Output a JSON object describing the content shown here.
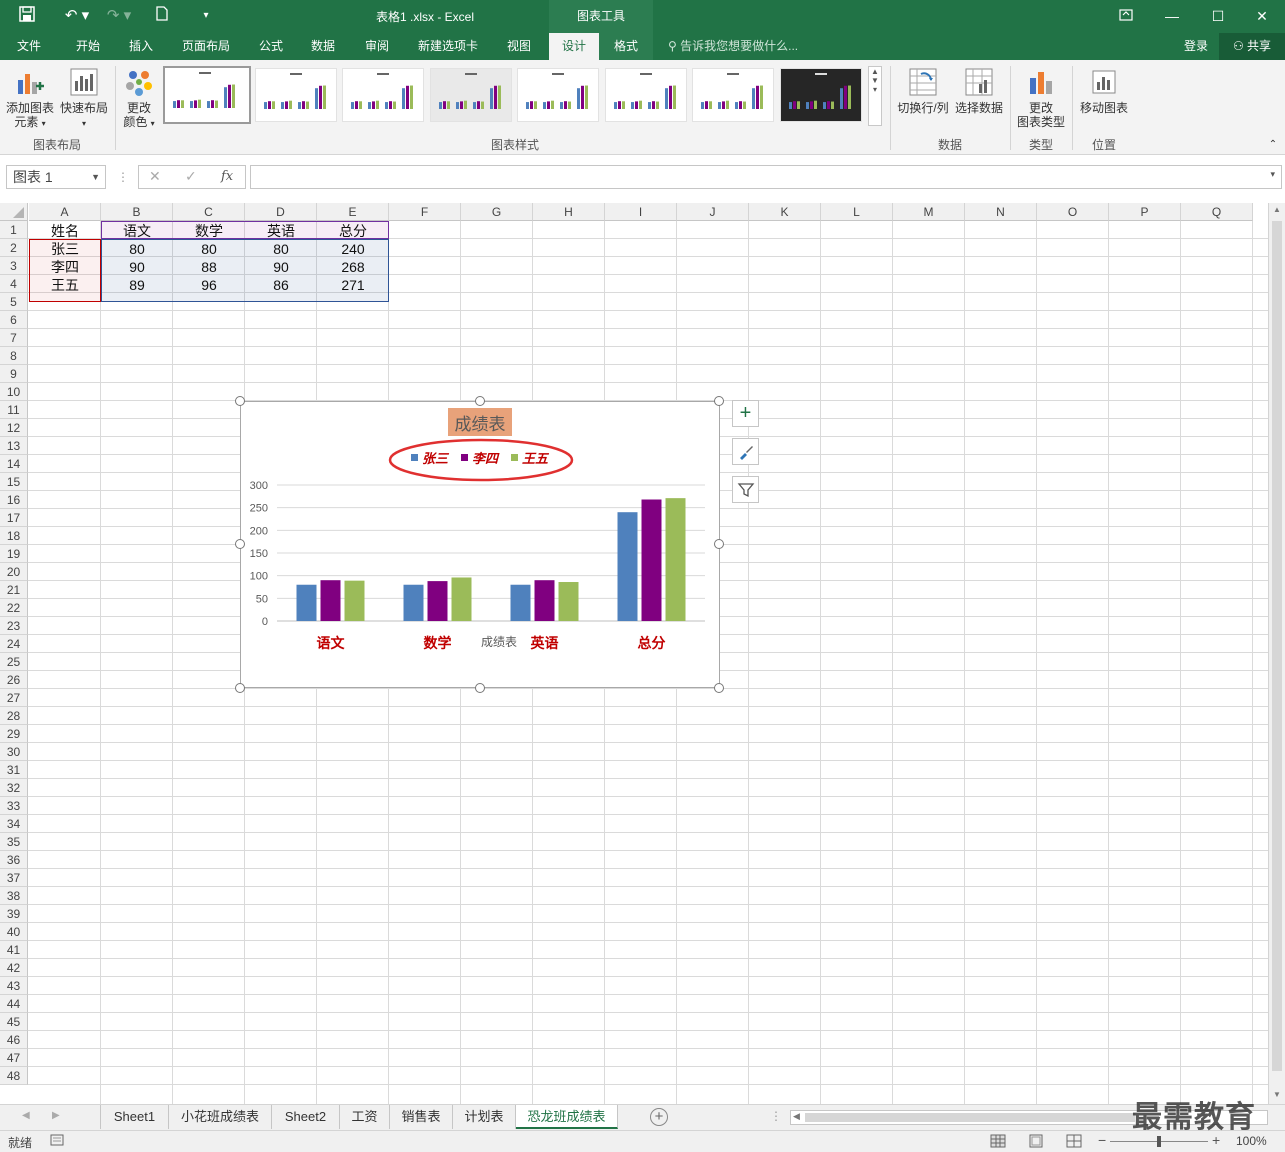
{
  "window": {
    "doc_title": "表格1 .xlsx - Excel",
    "context_tools": "图表工具"
  },
  "tabs": [
    "文件",
    "开始",
    "插入",
    "页面布局",
    "公式",
    "数据",
    "审阅",
    "新建选项卡",
    "视图",
    "设计",
    "格式"
  ],
  "active_tab": "设计",
  "tell_me": "告诉我您想要做什么...",
  "login": "登录",
  "share": "共享",
  "ribbon": {
    "add_element": [
      "添加图表",
      "元素"
    ],
    "quick_layout": "快速布局",
    "change_colors": [
      "更改",
      "颜色"
    ],
    "group_layout": "图表布局",
    "group_styles": "图表样式",
    "switch_row_col": "切换行/列",
    "select_data": "选择数据",
    "group_data": "数据",
    "change_type": [
      "更改",
      "图表类型"
    ],
    "group_type": "类型",
    "move_chart": "移动图表",
    "group_location": "位置"
  },
  "namebox": "图表 1",
  "columns": [
    "A",
    "B",
    "C",
    "D",
    "E",
    "F",
    "G",
    "H",
    "I",
    "J",
    "K",
    "L",
    "M",
    "N",
    "O",
    "P",
    "Q"
  ],
  "rows_count": 48,
  "table": {
    "header": [
      "姓名",
      "语文",
      "数学",
      "英语",
      "总分"
    ],
    "rows": [
      [
        "张三",
        "80",
        "80",
        "80",
        "240"
      ],
      [
        "李四",
        "90",
        "88",
        "90",
        "268"
      ],
      [
        "王五",
        "89",
        "96",
        "86",
        "271"
      ]
    ]
  },
  "chart_data": {
    "type": "bar",
    "title": "成绩表",
    "xlabel": "成绩表",
    "categories": [
      "语文",
      "数学",
      "英语",
      "总分"
    ],
    "series": [
      {
        "name": "张三",
        "color": "#4f81bd",
        "values": [
          80,
          80,
          80,
          240
        ]
      },
      {
        "name": "李四",
        "color": "#800080",
        "values": [
          90,
          88,
          90,
          268
        ]
      },
      {
        "name": "王五",
        "color": "#9bbb59",
        "values": [
          89,
          96,
          86,
          271
        ]
      }
    ],
    "ylim": [
      0,
      300
    ],
    "yticks": [
      "0",
      "50",
      "100",
      "150",
      "200",
      "250",
      "300"
    ],
    "grid": true,
    "legend": "top"
  },
  "sheets": [
    "Sheet1",
    "小花班成绩表",
    "Sheet2",
    "工资",
    "销售表",
    "计划表",
    "恐龙班成绩表"
  ],
  "active_sheet": "恐龙班成绩表",
  "status": {
    "ready": "就绪",
    "zoom": "100%"
  },
  "watermark": "最需教育"
}
